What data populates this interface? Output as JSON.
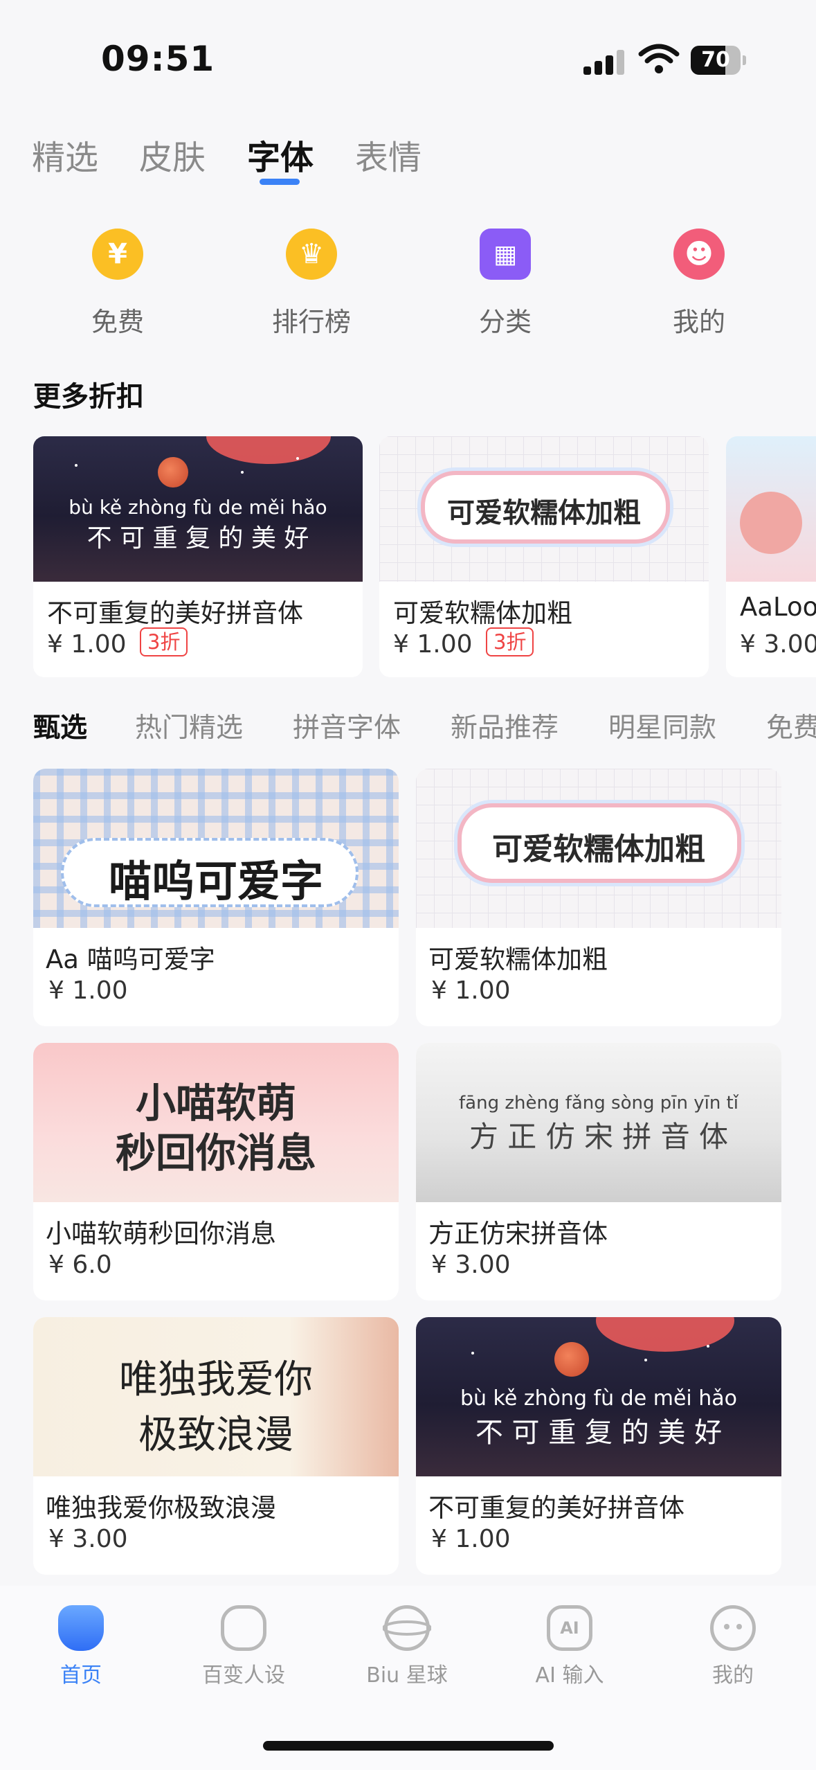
{
  "status_bar": {
    "time": "09:51",
    "battery": "70",
    "battery_level": 0.7
  },
  "top_tabs": [
    {
      "label": "精选",
      "active": false
    },
    {
      "label": "皮肤",
      "active": false
    },
    {
      "label": "字体",
      "active": true
    },
    {
      "label": "表情",
      "active": false
    }
  ],
  "categories": [
    {
      "label": "免费",
      "icon": "yen-icon",
      "glyph": "¥",
      "color": "#fbbf24"
    },
    {
      "label": "排行榜",
      "icon": "crown-icon",
      "glyph": "♛",
      "color": "#fbbf24"
    },
    {
      "label": "分类",
      "icon": "grid-icon",
      "glyph": "▦",
      "color": "#8b5cf6"
    },
    {
      "label": "我的",
      "icon": "smile-icon",
      "glyph": "☻",
      "color": "#f25d7a"
    }
  ],
  "discount_section": {
    "title": "更多折扣",
    "items": [
      {
        "name": "不可重复的美好拼音体",
        "price": "¥ 1.00",
        "badge": "3折"
      },
      {
        "name": "可爱软糯体加粗",
        "price": "¥ 1.00",
        "badge": "3折"
      },
      {
        "name": "AaLoo",
        "price": "¥ 3.00"
      }
    ]
  },
  "filter_tabs": [
    {
      "label": "甄选",
      "active": true
    },
    {
      "label": "热门精选",
      "active": false
    },
    {
      "label": "拼音字体",
      "active": false
    },
    {
      "label": "新品推荐",
      "active": false
    },
    {
      "label": "明星同款",
      "active": false
    },
    {
      "label": "免费",
      "active": false
    }
  ],
  "fonts": [
    {
      "name": "Aa 喵呜可爱字",
      "price": "¥ 1.00",
      "preview": "喵呜可爱字"
    },
    {
      "name": "可爱软糯体加粗",
      "price": "¥ 1.00",
      "preview": "可爱软糯体加粗"
    },
    {
      "name": "小喵软萌秒回你消息",
      "price": "¥ 6.0",
      "preview_line1": "小喵软萌",
      "preview_line2": "秒回你消息"
    },
    {
      "name": "方正仿宋拼音体",
      "price": "¥ 3.00",
      "preview": "方 正 仿 宋 拼 音 体",
      "pinyin": "fāng zhèng fǎng sòng pīn yīn tǐ"
    },
    {
      "name": "唯独我爱你极致浪漫",
      "price": "¥ 3.00",
      "preview_line1": "唯独我爱你",
      "preview_line2": "极致浪漫"
    },
    {
      "name": "不可重复的美好拼音体",
      "price": "¥ 1.00",
      "preview": "不 可 重 复 的 美 好",
      "pinyin": "bù kě zhòng fù de měi hǎo"
    }
  ],
  "bottom_nav": [
    {
      "label": "首页",
      "icon": "home-icon",
      "active": true
    },
    {
      "label": "百变人设",
      "icon": "persona-icon",
      "active": false
    },
    {
      "label": "Biu 星球",
      "icon": "planet-icon",
      "active": false
    },
    {
      "label": "AI 输入",
      "icon": "ai-icon",
      "glyph": "AI",
      "active": false
    },
    {
      "label": "我的",
      "icon": "face-icon",
      "active": false
    }
  ],
  "colors": {
    "accent": "#3b82f6",
    "discount_red": "#ef4444"
  }
}
